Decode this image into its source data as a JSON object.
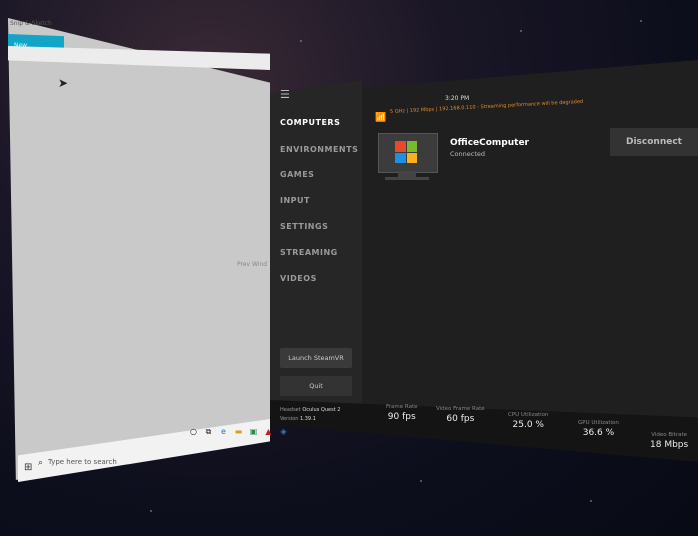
{
  "windows_desktop": {
    "title": "Snip & Sketch",
    "toolbar_item": "New",
    "side_text": "Prev Wind",
    "taskbar": {
      "search_placeholder": "Type here to search"
    }
  },
  "vd": {
    "time": "3:20 PM",
    "network_info": "5 GHz | 192 Mbps | 192.168.0.110 - Streaming performance will be degraded",
    "nav": [
      "COMPUTERS",
      "ENVIRONMENTS",
      "GAMES",
      "INPUT",
      "SETTINGS",
      "STREAMING",
      "VIDEOS"
    ],
    "active_nav": "COMPUTERS",
    "launch_label": "Launch SteamVR",
    "quit_label": "Quit",
    "computer": {
      "name": "OfficeComputer",
      "status": "Connected"
    },
    "disconnect_label": "Disconnect",
    "headset": {
      "label": "Headset",
      "value": "Oculus Quest 2",
      "version_label": "Version",
      "version_value": "1.39.1"
    },
    "stats": [
      {
        "label": "Frame Rate",
        "value": "90 fps"
      },
      {
        "label": "Video Frame Rate",
        "value": "60 fps"
      },
      {
        "label": "CPU Utilization",
        "value": "25.0 %"
      },
      {
        "label": "GPU Utilization",
        "value": "36.6 %"
      },
      {
        "label": "Video Bitrate",
        "value": "18 Mbps"
      }
    ]
  },
  "colors": {
    "windows_accent": "#12a5c8",
    "warning": "#e08a2c"
  }
}
